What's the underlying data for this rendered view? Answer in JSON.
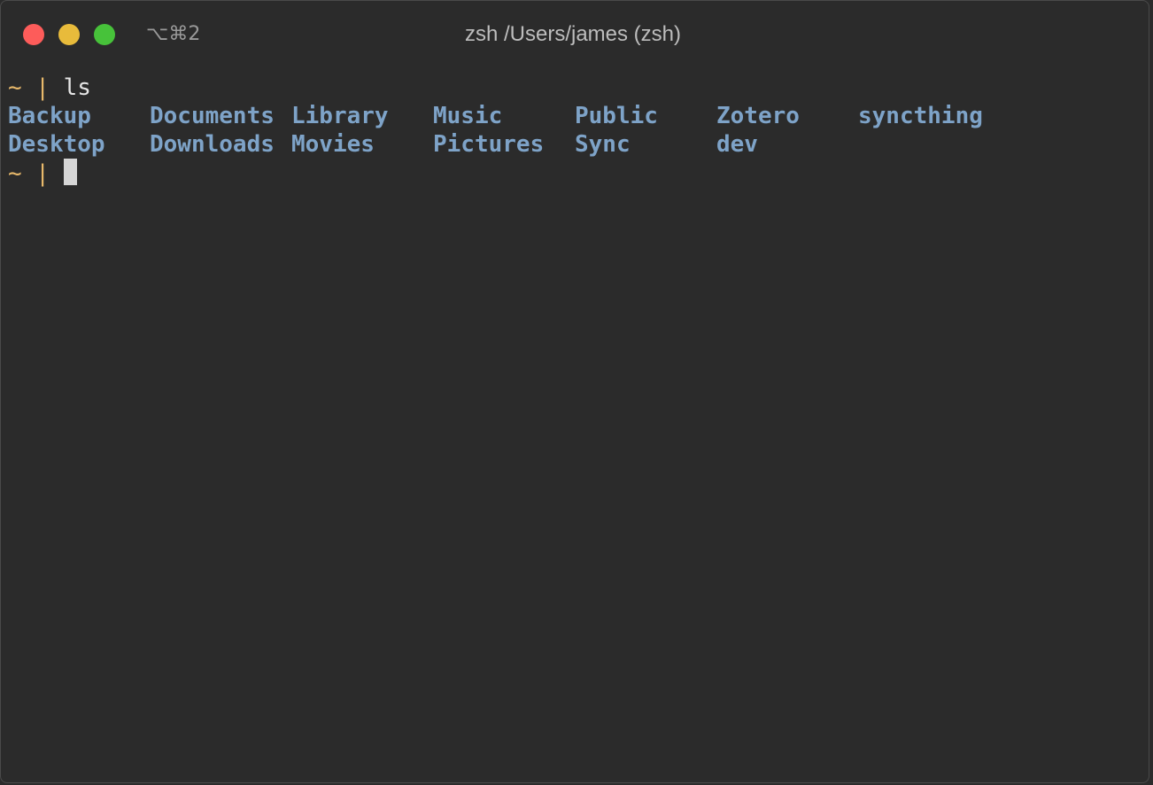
{
  "window": {
    "shortcut": "⌥⌘2",
    "title": "zsh /Users/james (zsh)"
  },
  "terminal": {
    "prompt": "~ | ",
    "command": "ls",
    "listing": [
      [
        "Backup",
        "Documents",
        "Library",
        "Music",
        "Public",
        "Zotero",
        "syncthing"
      ],
      [
        "Desktop",
        "Downloads",
        "Movies",
        "Pictures",
        "Sync",
        "dev"
      ]
    ]
  },
  "colors": {
    "background": "#2b2b2b",
    "prompt": "#e8b96b",
    "directory": "#7ea3c8",
    "text": "#e6e6e6",
    "close": "#fd5c5a",
    "minimize": "#e8bb3b",
    "zoom": "#47c23a"
  }
}
